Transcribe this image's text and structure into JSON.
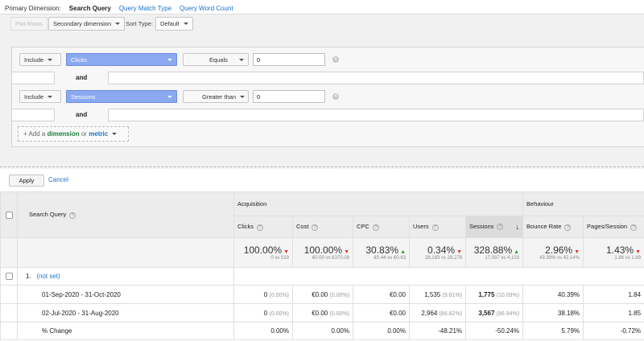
{
  "dimension_bar": {
    "label": "Primary Dimension:",
    "items": [
      "Search Query",
      "Query Match Type",
      "Query Word Count"
    ]
  },
  "toolbar": {
    "plot_rows": "Plot Rows",
    "secondary_dimension": "Secondary dimension",
    "sort_type_label": "Sort Type:",
    "sort_type_value": "Default"
  },
  "filters": [
    {
      "include": "Include",
      "metric": "Clicks",
      "operator": "Equals",
      "value": "0"
    },
    {
      "include": "Include",
      "metric": "Sessions",
      "operator": "Greater than",
      "value": "0"
    }
  ],
  "and_label": "and",
  "add_dimension": {
    "prefix": "+ Add a",
    "dimension": "dimension",
    "or": "or",
    "metric": "metric"
  },
  "actions": {
    "apply": "Apply",
    "cancel": "Cancel"
  },
  "table": {
    "query_header": "Search Query",
    "groups": {
      "acquisition": "Acquisition",
      "behaviour": "Behaviour"
    },
    "columns": [
      "Clicks",
      "Cost",
      "CPC",
      "Users",
      "Sessions",
      "Bounce Rate",
      "Pages/Session"
    ],
    "totals": [
      {
        "pct": "100.00%",
        "sub": "0 vs 519",
        "dir": "down"
      },
      {
        "pct": "100.00%",
        "sub": "€0.00 vs €370.08",
        "dir": "down"
      },
      {
        "pct": "30.83%",
        "sub": "€0.44 vs €0.63",
        "dir": "up"
      },
      {
        "pct": "0.34%",
        "sub": "28,183 vs 28,278",
        "dir": "down"
      },
      {
        "pct": "328.88%",
        "sub": "17,597 vs 4,103",
        "dir": "up"
      },
      {
        "pct": "2.96%",
        "sub": "43.39% vs 42.14%",
        "dir": "down"
      },
      {
        "pct": "1.43%",
        "sub": "1.86 vs 1.89",
        "dir": "down"
      }
    ],
    "row1": {
      "index": "1.",
      "name": "(not set)"
    },
    "period1": {
      "label": "01-Sep-2020 - 31-Oct-2020",
      "clicks": "0",
      "clicks_pct": "(0.00%)",
      "cost": "€0.00",
      "cost_pct": "(0.00%)",
      "cpc": "€0.00",
      "users": "1,535",
      "users_pct": "(9.61%)",
      "sessions": "1,775",
      "sessions_pct": "(10.09%)",
      "bounce": "40.39%",
      "pages": "1.84"
    },
    "period2": {
      "label": "02-Jul-2020 - 31-Aug-2020",
      "clicks": "0",
      "clicks_pct": "(0.00%)",
      "cost": "€0.00",
      "cost_pct": "(0.00%)",
      "cpc": "€0.00",
      "users": "2,964",
      "users_pct": "(86.82%)",
      "sessions": "3,567",
      "sessions_pct": "(86.94%)",
      "bounce": "38.18%",
      "pages": "1.85"
    },
    "change": {
      "label": "% Change",
      "values": [
        "0.00%",
        "0.00%",
        "0.00%",
        "-48.21%",
        "-50.24%",
        "5.79%",
        "-0.72%"
      ]
    }
  }
}
